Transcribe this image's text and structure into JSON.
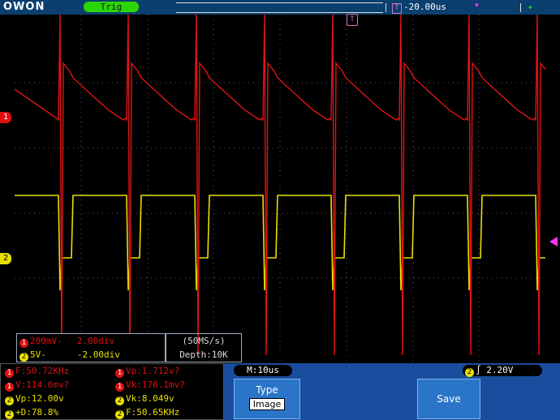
{
  "header": {
    "brand": "OWON",
    "trig_status": "Trig",
    "time_offset": "-20.00us",
    "trig_marker": "T",
    "usb_icon": "usb-icon"
  },
  "channels": {
    "ch1_marker": "1",
    "ch2_marker": "2",
    "ch1_color": "#e01414",
    "ch2_color": "#e8e000"
  },
  "settings": {
    "ch1_scale": "200mV-",
    "ch1_pos": "2.00div",
    "ch2_scale": "5V-",
    "ch2_pos": "-2.00div",
    "sample_rate": "(50MS/s)",
    "depth": "Depth:10K"
  },
  "measurements": {
    "ch1_freq": "F:50.72KHz",
    "ch1_vp": "Vp:1.712v?",
    "ch1_v": "V:114.6mv?",
    "ch1_vk": "Vk:176.1mv?",
    "ch2_vp": "Vp:12.00v",
    "ch2_vk": "Vk:8.049v",
    "ch2_duty": "+D:78.8%",
    "ch2_freq": "F:50.65KHz"
  },
  "status": {
    "timebase": "M:10us",
    "trigger_channel": "2",
    "trigger_level": "2.20V"
  },
  "menu": {
    "type_label": "Type",
    "type_value": "Image",
    "save_label": "Save"
  }
}
